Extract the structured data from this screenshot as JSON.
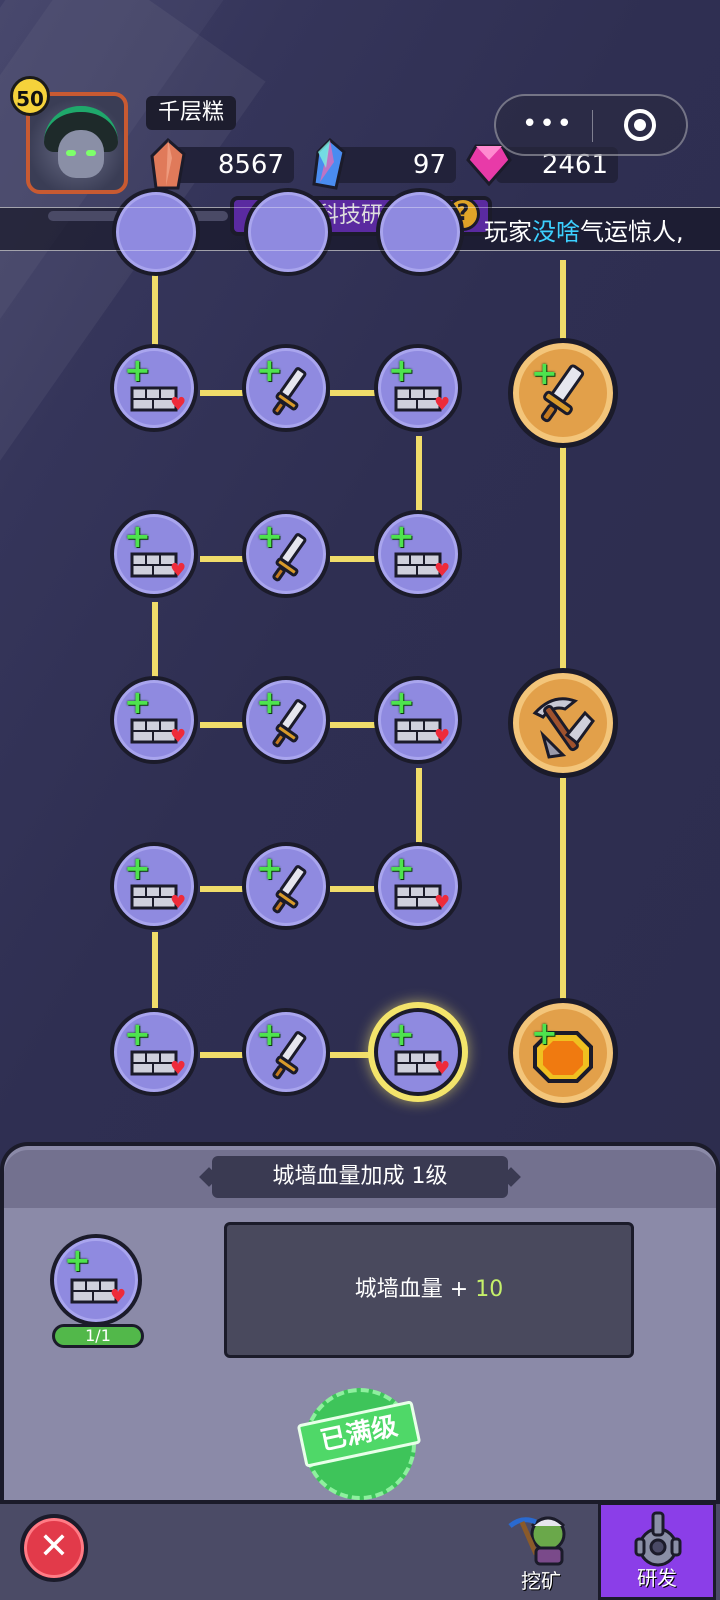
{
  "player": {
    "level": "50",
    "name": "千层糕",
    "avatar_icon": "monster-avatar-icon"
  },
  "resources": [
    {
      "name": "copper-crystal-icon",
      "value": "8567",
      "color": "#e07a5a"
    },
    {
      "name": "blue-crystal-icon",
      "value": "97",
      "color": "#4a8cf0"
    },
    {
      "name": "pink-gem-icon",
      "value": "2461",
      "color": "#e83aa8"
    }
  ],
  "title": "科技研发",
  "help_label": "?",
  "ticker": {
    "prefix": "玩家",
    "highlight": "没啥",
    "suffix": "气运惊人,"
  },
  "tree": {
    "wall_hp_icon": "wall-hp-bonus-icon",
    "attack_icon": "sword-attack-bonus-icon",
    "big_nodes": [
      "sword-upgrade-icon",
      "pickaxe-upgrade-icon",
      "gold-coin-upgrade-icon"
    ]
  },
  "detail": {
    "title": "城墙血量加成  1级",
    "count": "1/1",
    "desc_label": "城墙血量 + ",
    "desc_value": "10",
    "stamp": "已满级"
  },
  "nav": {
    "close_icon": "close-icon",
    "tabs": [
      {
        "label": "挖矿",
        "icon": "miner-goblin-icon",
        "active": false
      },
      {
        "label": "研发",
        "icon": "research-gear-icon",
        "active": true
      }
    ]
  }
}
